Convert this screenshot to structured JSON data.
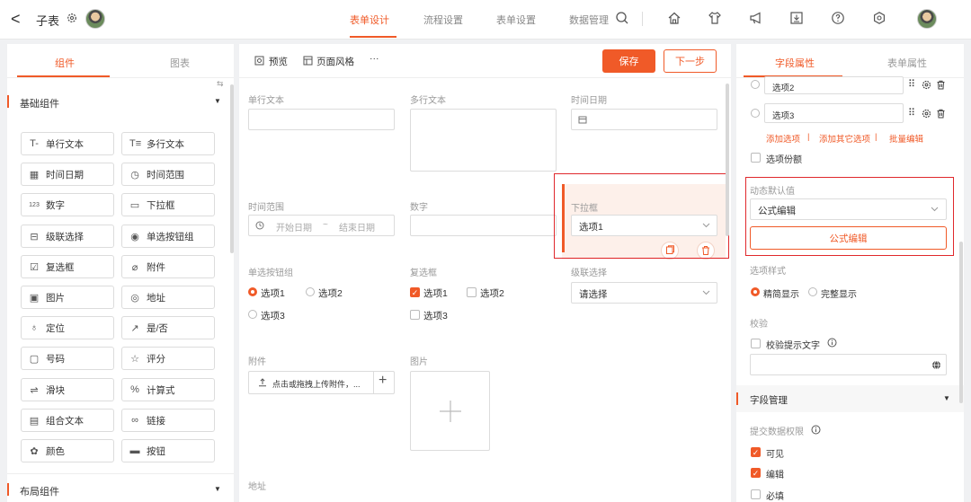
{
  "topbar": {
    "back_label": "<",
    "title": "子表",
    "nav": [
      "表单设计",
      "流程设置",
      "表单设置",
      "数据管理"
    ]
  },
  "left": {
    "tabs": [
      "组件",
      "图表"
    ],
    "basic_section": "基础组件",
    "layout_section": "布局组件",
    "components": [
      {
        "icon": "T-",
        "label": "单行文本"
      },
      {
        "icon": "T≡",
        "label": "多行文本"
      },
      {
        "icon": "▦",
        "label": "时间日期"
      },
      {
        "icon": "◷",
        "label": "时间范围"
      },
      {
        "icon": "123",
        "label": "数字"
      },
      {
        "icon": "▭",
        "label": "下拉框"
      },
      {
        "icon": "⊟",
        "label": "级联选择"
      },
      {
        "icon": "◉",
        "label": "单选按钮组"
      },
      {
        "icon": "☑",
        "label": "复选框"
      },
      {
        "icon": "⌀",
        "label": "附件"
      },
      {
        "icon": "▣",
        "label": "图片"
      },
      {
        "icon": "◎",
        "label": "地址"
      },
      {
        "icon": "♁",
        "label": "定位"
      },
      {
        "icon": "↗",
        "label": "是/否"
      },
      {
        "icon": "▢",
        "label": "号码"
      },
      {
        "icon": "☆",
        "label": "评分"
      },
      {
        "icon": "⇌",
        "label": "滑块"
      },
      {
        "icon": "%",
        "label": "计算式"
      },
      {
        "icon": "▤",
        "label": "组合文本"
      },
      {
        "icon": "∞",
        "label": "链接"
      },
      {
        "icon": "✿",
        "label": "颜色"
      },
      {
        "icon": "▬",
        "label": "按钮"
      }
    ]
  },
  "center": {
    "toolbar": {
      "preview": "预览",
      "page_style": "页面风格",
      "more": "···",
      "save": "保存",
      "next": "下一步"
    },
    "fields": {
      "single_text": "单行文本",
      "multi_text": "多行文本",
      "datetime": "时间日期",
      "time_range": "时间范围",
      "start_date": "开始日期",
      "tilde": "~",
      "end_date": "结束日期",
      "number": "数字",
      "dropdown": "下拉框",
      "dropdown_value": "选项1",
      "radio_group": "单选按钮组",
      "radio_options": [
        "选项1",
        "选项2",
        "选项3"
      ],
      "checkbox": "复选框",
      "checkbox_options": [
        "选项1",
        "选项2",
        "选项3"
      ],
      "cascade": "级联选择",
      "cascade_placeholder": "请选择",
      "attachment": "附件",
      "upload_text": "点击或拖拽上传附件，...",
      "image": "图片",
      "address": "地址"
    }
  },
  "right": {
    "tabs": [
      "字段属性",
      "表单属性"
    ],
    "options": [
      "选项2",
      "选项3"
    ],
    "links": [
      "添加选项",
      "添加其它选项",
      "批量编辑"
    ],
    "separator": "|",
    "option_share": "选项份额",
    "dynamic_default": "动态默认值",
    "formula_select": "公式编辑",
    "formula_button": "公式编辑",
    "option_style": "选项样式",
    "style_options": [
      "精简显示",
      "完整显示"
    ],
    "validation": "校验",
    "validation_hint": "校验提示文字",
    "field_mgmt": "字段管理",
    "submit_perm": "提交数据权限",
    "perms": [
      "可见",
      "编辑",
      "必填"
    ]
  },
  "colors": {
    "accent": "#f05a28",
    "highlight": "#e0282c"
  }
}
